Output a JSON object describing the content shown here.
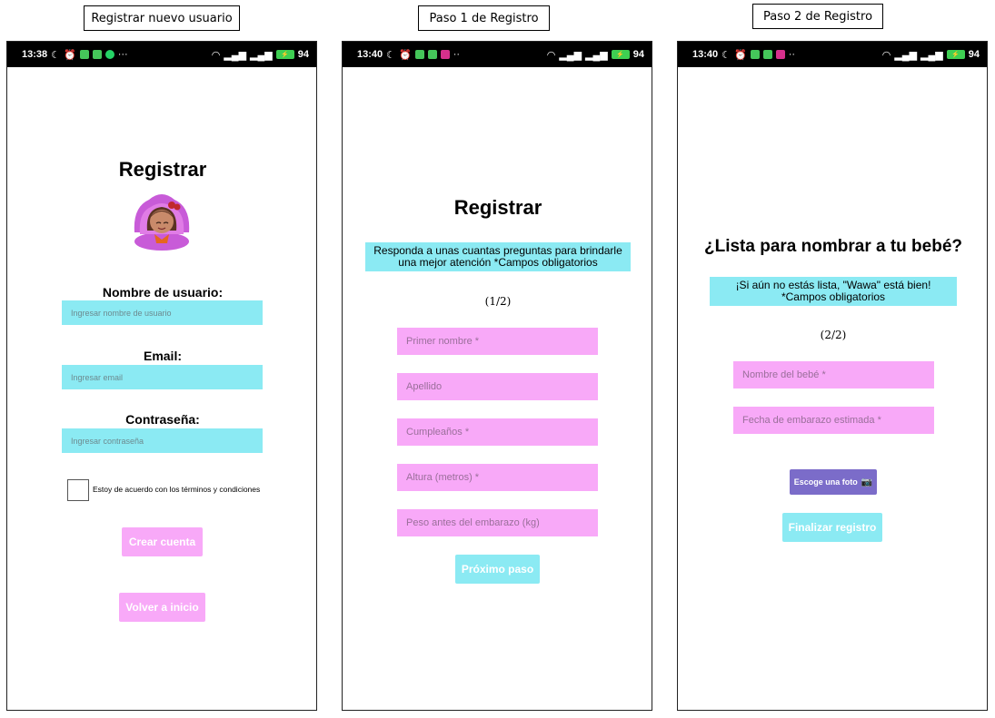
{
  "captions": [
    "Registrar nuevo usuario",
    "Paso 1 de Registro",
    "Paso 2 de Registro"
  ],
  "screen1": {
    "status": {
      "time": "13:38",
      "battery": "94"
    },
    "title": "Registrar",
    "username_label": "Nombre de usuario:",
    "username_placeholder": "Ingresar nombre de usuario",
    "email_label": "Email:",
    "email_placeholder": "Ingresar email",
    "password_label": "Contraseña:",
    "password_placeholder": "Ingresar contraseña",
    "terms_label": "Estoy de acuerdo con los términos y condiciones",
    "create_button": "Crear cuenta",
    "back_button": "Volver a inicio"
  },
  "screen2": {
    "status": {
      "time": "13:40",
      "battery": "94"
    },
    "title": "Registrar",
    "info": "Responda a unas cuantas  preguntas para brindarle una mejor atención *Campos obligatorios",
    "step": "(1/2)",
    "fields": [
      "Primer nombre *",
      "Apellido",
      "Cumpleaños *",
      "Altura (metros) *",
      "Peso antes del embarazo (kg)"
    ],
    "next_button": "Próximo paso"
  },
  "screen3": {
    "status": {
      "time": "13:40",
      "battery": "94"
    },
    "title": "¿Lista para nombrar a tu bebé?",
    "info": "¡Si aún no estás lista, \"Wawa\" está bien! *Campos obligatorios",
    "step": "(2/2)",
    "fields": [
      "Nombre del bebé *",
      "Fecha de embarazo estimada *"
    ],
    "photo_button": "Escoge una foto",
    "finish_button": "Finalizar registro"
  },
  "colors": {
    "cyan": "#8beaf3",
    "pink": "#f8a9f8",
    "purple": "#7b6cc9"
  },
  "icons": [
    "moon-icon",
    "alarm-icon",
    "wifi-icon",
    "signal-icon",
    "battery-icon",
    "avatar-illustration",
    "camera-icon"
  ]
}
